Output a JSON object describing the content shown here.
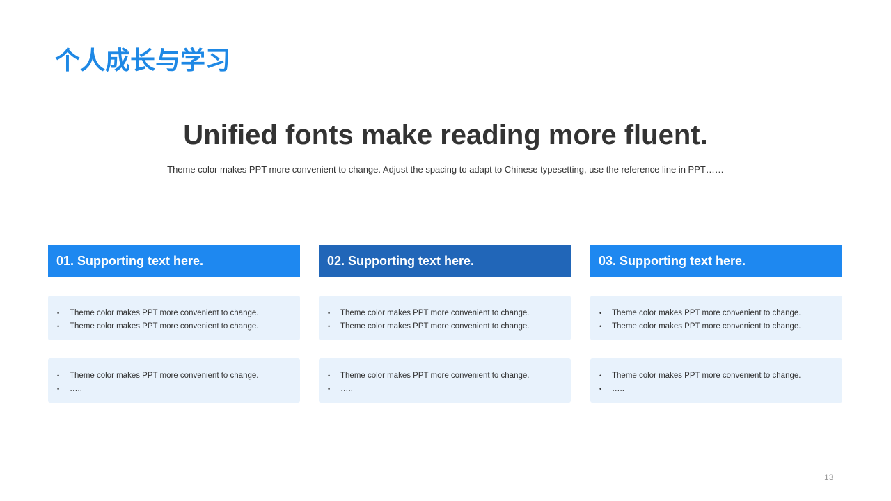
{
  "slide": {
    "title": "个人成长与学习",
    "headline": "Unified fonts make reading more fluent.",
    "subheadline": "Theme color makes PPT more convenient to change. Adjust the spacing to adapt to Chinese typesetting, use the reference line in PPT……",
    "page_number": "13"
  },
  "colors": {
    "title": "#1e88e5",
    "header_light": "#1e88f0",
    "header_dark": "#2166b8",
    "card_bg": "#e8f2fc",
    "text": "#333333"
  },
  "columns": [
    {
      "header": "01. Supporting text here.",
      "cards": [
        [
          "Theme color makes PPT more convenient to change.",
          "Theme color makes PPT more convenient to change."
        ],
        [
          "Theme color makes PPT more convenient to change.",
          "….."
        ]
      ]
    },
    {
      "header": "02. Supporting text here.",
      "cards": [
        [
          "Theme color makes PPT more convenient to change.",
          "Theme color makes PPT more convenient to change."
        ],
        [
          "Theme color makes PPT more convenient to change.",
          "….."
        ]
      ]
    },
    {
      "header": "03. Supporting text here.",
      "cards": [
        [
          "Theme color makes PPT more convenient to change.",
          "Theme color makes PPT more convenient to change."
        ],
        [
          "Theme color makes PPT more convenient to change.",
          "….."
        ]
      ]
    }
  ],
  "bullet_glyph": "•"
}
